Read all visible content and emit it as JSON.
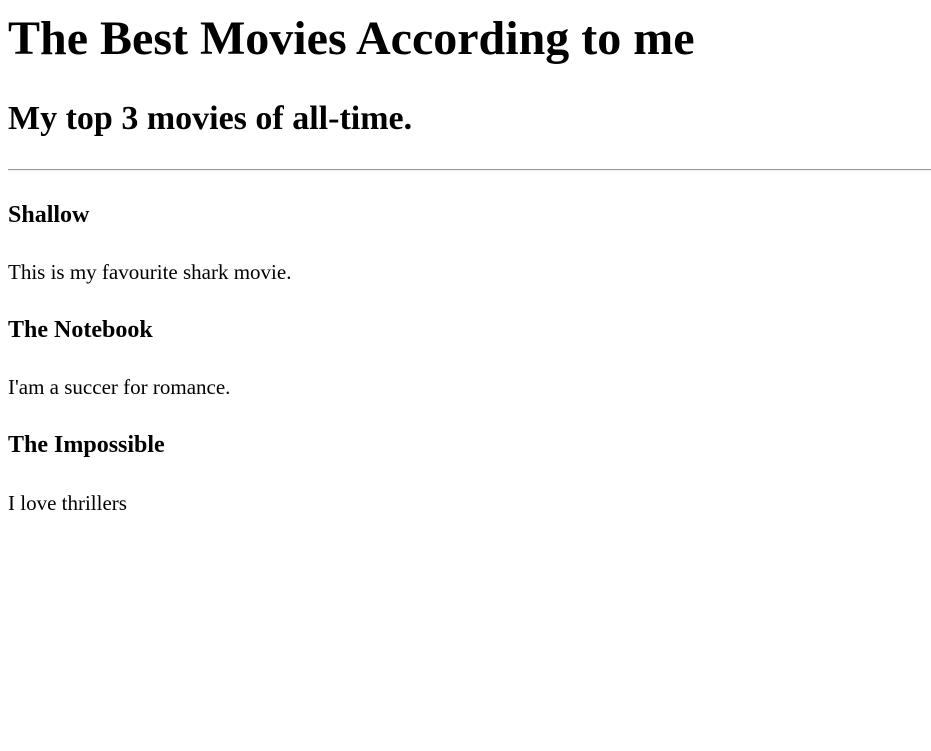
{
  "page": {
    "title": "The Best Movies According to me",
    "subtitle": "My top 3 movies of all-time."
  },
  "movies": [
    {
      "title": "Shallow",
      "description": "This is my favourite shark movie."
    },
    {
      "title": "The Notebook",
      "description": "I'am a succer for romance."
    },
    {
      "title": "The Impossible",
      "description": "I love thrillers"
    }
  ]
}
